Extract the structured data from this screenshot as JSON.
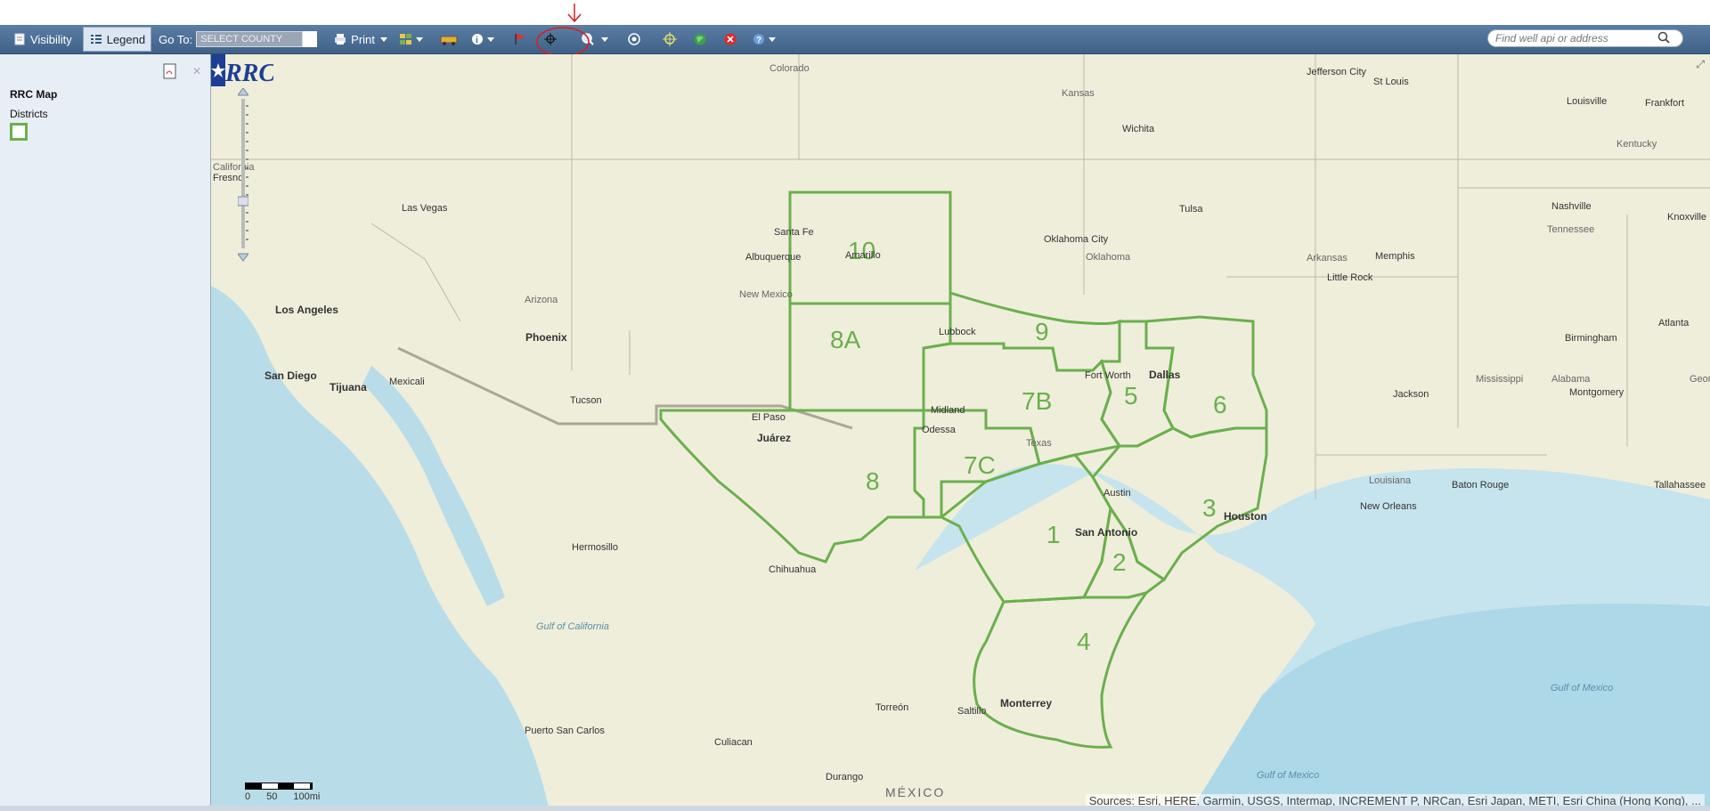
{
  "toolbar": {
    "visibility_label": "Visibility",
    "legend_label": "Legend",
    "goto_label": "Go To:",
    "goto_select_value": "SELECT COUNTY",
    "print_label": "Print",
    "search_placeholder": "Find well api or address"
  },
  "sidebar": {
    "title": "RRC Map",
    "layer_label": "Districts",
    "swatch_color": "#6ab04c"
  },
  "map": {
    "district_color": "#6ab04c",
    "district_labels": [
      "10",
      "8A",
      "9",
      "7B",
      "5",
      "6",
      "7C",
      "8",
      "1",
      "3",
      "2",
      "4"
    ],
    "place_labels": [
      "Colorado",
      "Kansas",
      "Wichita",
      "Jefferson City",
      "St Louis",
      "Louisville",
      "Frankfort",
      "Kentucky",
      "Las Vegas",
      "Santa Fe",
      "Tulsa",
      "Nashville",
      "Knoxville",
      "Tennessee",
      "Albuquerque",
      "Amarillo",
      "Oklahoma City",
      "Oklahoma",
      "Arkansas",
      "Memphis",
      "Little Rock",
      "New Mexico",
      "Arizona",
      "Los Angeles",
      "Phoenix",
      "Lubbock",
      "Fort Worth",
      "Dallas",
      "Birmingham",
      "Atlanta",
      "San Diego",
      "Tijuana",
      "Mexicali",
      "Tucson",
      "Midland",
      "Odessa",
      "El Paso",
      "Juárez",
      "Jackson",
      "Mississippi",
      "Alabama",
      "Montgomery",
      "Georgia",
      "Austin",
      "Houston",
      "San Antonio",
      "Louisiana",
      "Baton Rouge",
      "New Orleans",
      "Tallahassee",
      "Hermosillo",
      "Chihuahua",
      "Gulf of California",
      "Monterrey",
      "Torreón",
      "Saltillo",
      "Culiacan",
      "Durango",
      "MÉXICO",
      "Puerto San Carlos",
      "Gulf of Mexico",
      "Gulf of Mexico",
      "Texas",
      "Fresno",
      "California"
    ],
    "scale_ticks": [
      "0",
      "50",
      "100mi"
    ],
    "attribution": "Sources: Esri, HERE, Garmin, USGS, Intermap, INCREMENT P, NRCan, Esri Japan, METI, Esri China (Hong Kong), ...",
    "logo_text": "RRC"
  }
}
